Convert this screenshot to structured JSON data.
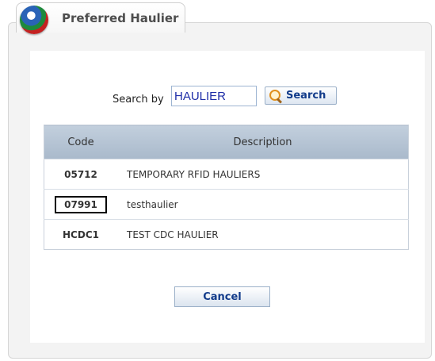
{
  "tab": {
    "title": "Preferred Haulier"
  },
  "search": {
    "label": "Search by",
    "value": "HAULIER",
    "button_label": "Search"
  },
  "table": {
    "headers": {
      "code": "Code",
      "description": "Description"
    },
    "rows": [
      {
        "code": "05712",
        "description": "TEMPORARY RFID HAULIERS"
      },
      {
        "code": "07991",
        "description": "testhaulier"
      },
      {
        "code": "HCDC1",
        "description": "TEST CDC HAULIER"
      }
    ]
  },
  "actions": {
    "cancel_label": "Cancel"
  },
  "colors": {
    "code_text": "#8c7417",
    "header_bg": "#b4c3d4",
    "button_text": "#123b8a"
  }
}
